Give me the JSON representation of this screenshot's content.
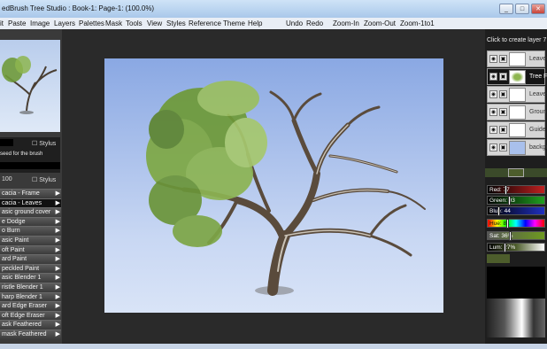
{
  "window": {
    "title": "edBrush Tree Studio : Book-1: Page-1:  (100.0%)",
    "buttons": [
      "_",
      "□",
      "✕"
    ]
  },
  "menu": {
    "items": [
      "it",
      "Paste",
      "Image",
      "Layers",
      "Palettes",
      "Mask",
      "Tools",
      "View",
      "Styles",
      "Reference",
      "Theme",
      "Help",
      "Undo",
      "Redo",
      "Zoom-In",
      "Zoom-Out",
      "Zoom-1to1"
    ]
  },
  "brush_panel": {
    "stylus_label": "Stylus",
    "hint": "seed for the brush",
    "size_value": "100",
    "brushes": [
      {
        "label": "cacia - Frame"
      },
      {
        "label": "cacia - Leaves",
        "selected": true
      },
      {
        "label": "asic ground cover"
      },
      {
        "label": "e Dodge"
      },
      {
        "label": "o Burn"
      },
      {
        "label": "asic Paint"
      },
      {
        "label": "oft Paint"
      },
      {
        "label": "ard Paint"
      },
      {
        "label": "peckled Paint"
      },
      {
        "label": "asic Blender 1"
      },
      {
        "label": "ristle Blender 1"
      },
      {
        "label": "harp Blender 1"
      },
      {
        "label": "ard Edge Eraser"
      },
      {
        "label": "oft Edge Eraser"
      },
      {
        "label": "ask Feathered"
      },
      {
        "label": "mask Feathered"
      }
    ]
  },
  "layers": {
    "header": "Click to create layer 7",
    "items": [
      {
        "name": "Leaves"
      },
      {
        "name": "Tree Fr",
        "selected": true
      },
      {
        "name": "Leaves"
      },
      {
        "name": "Ground"
      },
      {
        "name": "Guide"
      },
      {
        "name": "backgr"
      }
    ]
  },
  "color": {
    "sliders": [
      {
        "label": "Red:",
        "value": "77"
      },
      {
        "label": "Green:",
        "value": "93"
      },
      {
        "label": "Blue:",
        "value": "44"
      },
      {
        "label": "Hue:",
        "value": "81"
      },
      {
        "label": "Sat:",
        "value": "36%"
      },
      {
        "label": "Lum:",
        "value": "27%"
      }
    ],
    "current": "#4d5d2c"
  }
}
